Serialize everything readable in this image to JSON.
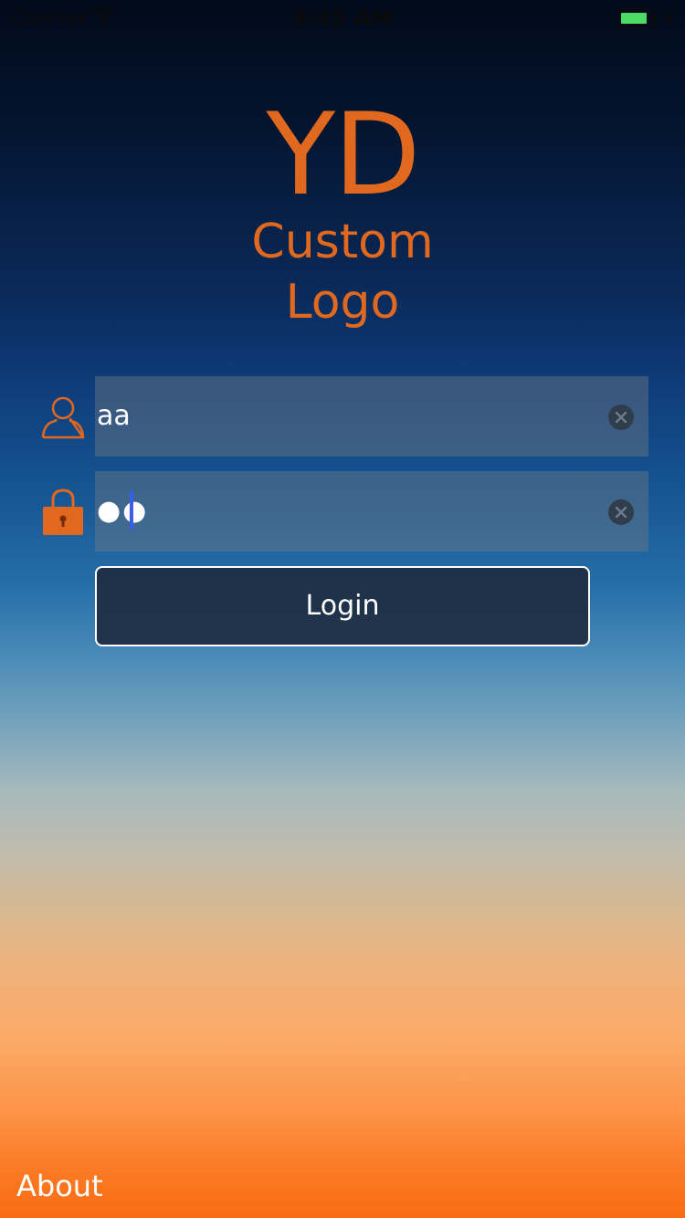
{
  "status_bar": {
    "carrier": "Carrier",
    "time": "9:45 AM"
  },
  "logo": {
    "mark": "YD",
    "line1": "Custom",
    "line2": "Logo"
  },
  "login_form": {
    "username_value": "aa",
    "password_value": "●●",
    "login_label": "Login"
  },
  "footer": {
    "about_label": "About"
  },
  "icons": {
    "user": "user-icon",
    "lock": "lock-icon",
    "clear": "clear-icon",
    "wifi": "wifi-icon",
    "battery": "battery-icon"
  },
  "colors": {
    "brand_orange": "#e0691f",
    "caret": "#3a5ee8",
    "battery_fill": "#4cd964"
  }
}
